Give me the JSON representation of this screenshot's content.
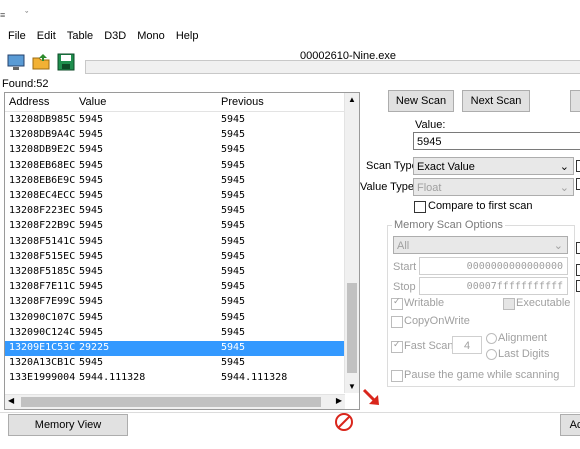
{
  "menu": [
    "File",
    "Edit",
    "Table",
    "D3D",
    "Mono",
    "Help"
  ],
  "window_title": "00002610-Nine.exe",
  "found_text": "Found:52",
  "columns": {
    "address": "Address",
    "value": "Value",
    "previous": "Previous"
  },
  "results": [
    {
      "address": "13208DB985C",
      "value": "5945",
      "previous": "5945"
    },
    {
      "address": "13208DB9A4C",
      "value": "5945",
      "previous": "5945"
    },
    {
      "address": "13208DB9E2C",
      "value": "5945",
      "previous": "5945"
    },
    {
      "address": "13208EB68EC",
      "value": "5945",
      "previous": "5945"
    },
    {
      "address": "13208EB6E9C",
      "value": "5945",
      "previous": "5945"
    },
    {
      "address": "13208EC4ECC",
      "value": "5945",
      "previous": "5945"
    },
    {
      "address": "13208F223EC",
      "value": "5945",
      "previous": "5945"
    },
    {
      "address": "13208F22B9C",
      "value": "5945",
      "previous": "5945"
    },
    {
      "address": "13208F5141C",
      "value": "5945",
      "previous": "5945"
    },
    {
      "address": "13208F515EC",
      "value": "5945",
      "previous": "5945"
    },
    {
      "address": "13208F5185C",
      "value": "5945",
      "previous": "5945"
    },
    {
      "address": "13208F7E11C",
      "value": "5945",
      "previous": "5945"
    },
    {
      "address": "13208F7E99C",
      "value": "5945",
      "previous": "5945"
    },
    {
      "address": "132090C107C",
      "value": "5945",
      "previous": "5945"
    },
    {
      "address": "132090C124C",
      "value": "5945",
      "previous": "5945"
    },
    {
      "address": "13209E1C53C",
      "value": "29225",
      "previous": "5945"
    },
    {
      "address": "1320A13CB1C",
      "value": "5945",
      "previous": "5945"
    },
    {
      "address": "133E1999004",
      "value": "5944.111328",
      "previous": "5944.111328"
    }
  ],
  "selected_row": 15,
  "buttons": {
    "new_scan": "New Scan",
    "next_scan": "Next Scan",
    "memory_view": "Memory View",
    "add_address": "Ac"
  },
  "value_label": "Value:",
  "value_input": "5945",
  "scan_type_label": "Scan Type",
  "scan_type_value": "Exact Value",
  "value_type_label": "Value Type",
  "value_type_value": "Float",
  "compare_first": "Compare to first scan",
  "mem_options_title": "Memory Scan Options",
  "mem_region": "All",
  "start_label": "Start",
  "start_value": "0000000000000000",
  "stop_label": "Stop",
  "stop_value": "00007fffffffffff",
  "writable": "Writable",
  "executable": "Executable",
  "copy_on_write": "CopyOnWrite",
  "fast_scan": "Fast Scan",
  "fast_scan_value": "4",
  "alignment": "Alignment",
  "last_digits": "Last Digits",
  "pause_game": "Pause the game while scanning",
  "colors": {
    "selection": "#3399ff",
    "arrow_red": "#d9261c",
    "toolbar_blue": "#2b6cb0"
  }
}
